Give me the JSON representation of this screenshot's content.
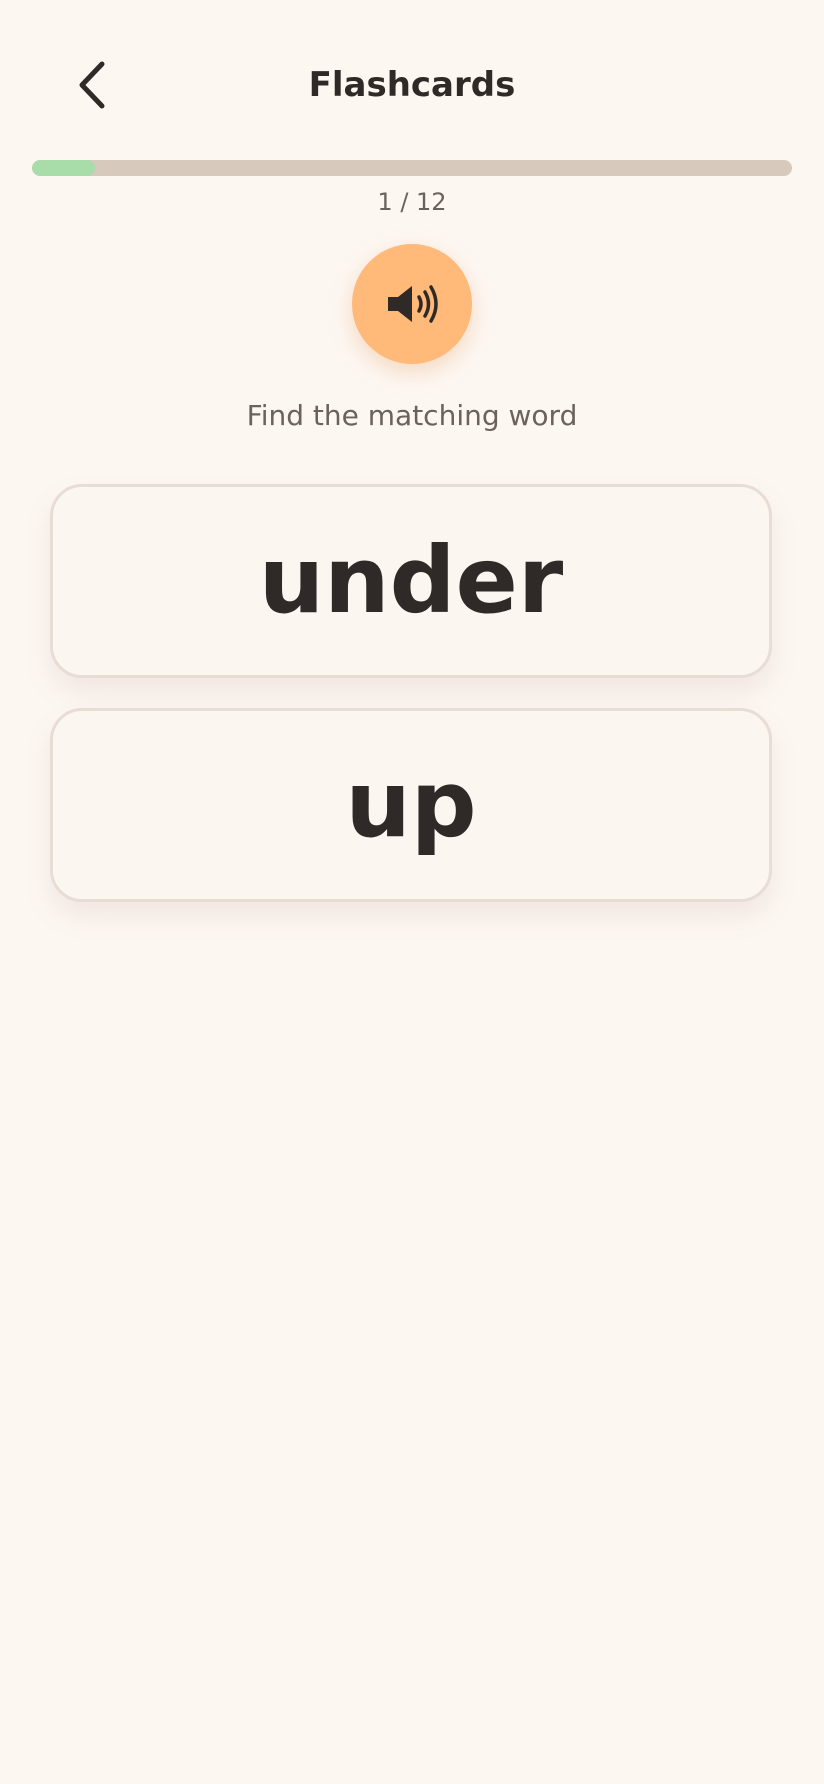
{
  "header": {
    "title": "Flashcards",
    "back_icon": "chevron-left-icon"
  },
  "progress": {
    "label": "1 / 12",
    "current": 1,
    "total": 12,
    "fill_color": "#a8dca8",
    "track_color": "#d8c9bd"
  },
  "audio": {
    "icon": "speaker-icon",
    "button_color": "#ffb979"
  },
  "instruction": "Find the matching word",
  "choices": [
    {
      "word": "under"
    },
    {
      "word": "up"
    }
  ]
}
